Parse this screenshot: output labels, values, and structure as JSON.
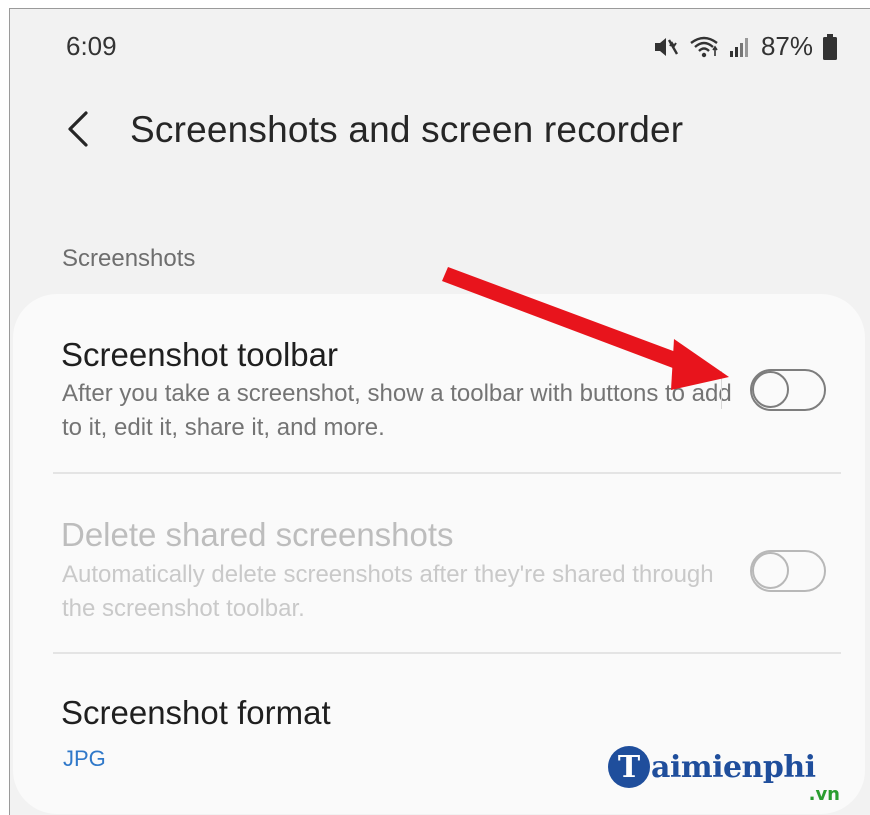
{
  "status_bar": {
    "time": "6:09",
    "battery": "87%",
    "icons": [
      "mute-vibrate-icon",
      "wifi-icon",
      "signal-icon",
      "battery-icon"
    ]
  },
  "header": {
    "back_icon": "chevron-left-icon",
    "title": "Screenshots and screen recorder"
  },
  "section": {
    "title": "Screenshots"
  },
  "settings": {
    "toolbar": {
      "title": "Screenshot toolbar",
      "description": "After you take a screenshot, show a toolbar with buttons to add to it, edit it, share it, and more.",
      "enabled": false
    },
    "delete_shared": {
      "title": "Delete shared screenshots",
      "description": "Automatically delete screenshots after they're shared through the screenshot toolbar.",
      "enabled": false,
      "disabled_state": true
    },
    "format": {
      "title": "Screenshot format",
      "value": "JPG"
    }
  },
  "annotation": {
    "arrow_icon": "red-arrow-icon",
    "arrow_color": "#e8141c"
  },
  "watermark": {
    "logo_letter": "T",
    "text": "aimienphi",
    "tld": ".vn"
  },
  "colors": {
    "background": "#f2f2f2",
    "card": "#fafafa",
    "accent_value": "#2f78c9"
  }
}
